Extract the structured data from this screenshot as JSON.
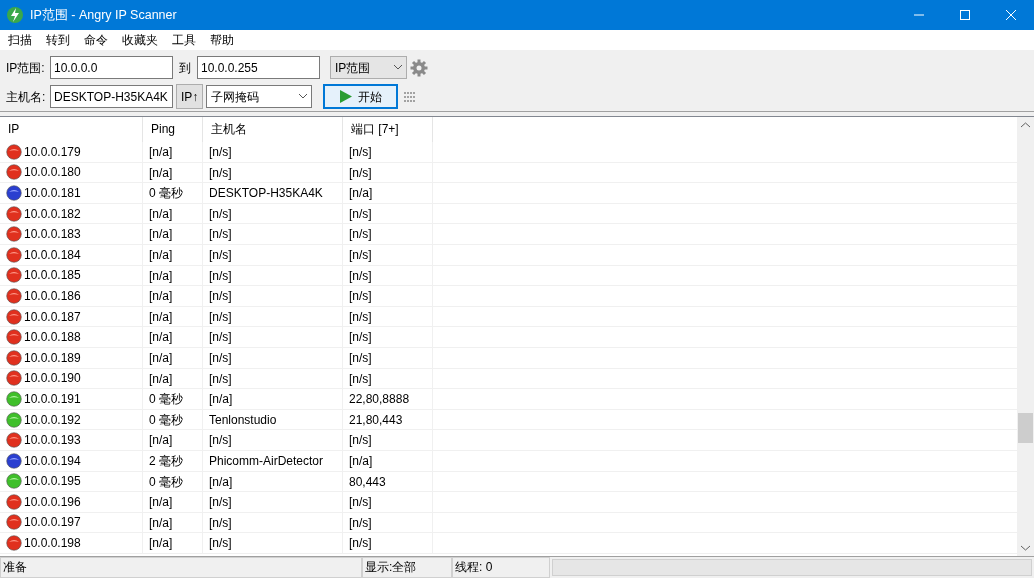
{
  "window": {
    "title": "IP范围 - Angry IP Scanner"
  },
  "menu": [
    "扫描",
    "转到",
    "命令",
    "收藏夹",
    "工具",
    "帮助"
  ],
  "toolbar": {
    "range_label": "IP范围:",
    "start_ip": "10.0.0.0",
    "to_label": "到",
    "end_ip": "10.0.0.255",
    "mode_select": "IP范围",
    "hostname_label": "主机名:",
    "hostname": "DESKTOP-H35KA4K",
    "ip_button": "IP↑",
    "netmask_select": "子网掩码",
    "start_button": "开始"
  },
  "table": {
    "columns": [
      "IP",
      "Ping",
      "主机名",
      "端口 [7+]"
    ],
    "rows": [
      {
        "color": "#e0301e",
        "ip": "10.0.0.179",
        "ping": "[n/a]",
        "hostname": "[n/s]",
        "ports": "[n/s]"
      },
      {
        "color": "#e0301e",
        "ip": "10.0.0.180",
        "ping": "[n/a]",
        "hostname": "[n/s]",
        "ports": "[n/s]"
      },
      {
        "color": "#2a3fd0",
        "ip": "10.0.0.181",
        "ping": "0 毫秒",
        "hostname": "DESKTOP-H35KA4K",
        "ports": "[n/a]"
      },
      {
        "color": "#e0301e",
        "ip": "10.0.0.182",
        "ping": "[n/a]",
        "hostname": "[n/s]",
        "ports": "[n/s]"
      },
      {
        "color": "#e0301e",
        "ip": "10.0.0.183",
        "ping": "[n/a]",
        "hostname": "[n/s]",
        "ports": "[n/s]"
      },
      {
        "color": "#e0301e",
        "ip": "10.0.0.184",
        "ping": "[n/a]",
        "hostname": "[n/s]",
        "ports": "[n/s]"
      },
      {
        "color": "#e0301e",
        "ip": "10.0.0.185",
        "ping": "[n/a]",
        "hostname": "[n/s]",
        "ports": "[n/s]"
      },
      {
        "color": "#e0301e",
        "ip": "10.0.0.186",
        "ping": "[n/a]",
        "hostname": "[n/s]",
        "ports": "[n/s]"
      },
      {
        "color": "#e0301e",
        "ip": "10.0.0.187",
        "ping": "[n/a]",
        "hostname": "[n/s]",
        "ports": "[n/s]"
      },
      {
        "color": "#e0301e",
        "ip": "10.0.0.188",
        "ping": "[n/a]",
        "hostname": "[n/s]",
        "ports": "[n/s]"
      },
      {
        "color": "#e0301e",
        "ip": "10.0.0.189",
        "ping": "[n/a]",
        "hostname": "[n/s]",
        "ports": "[n/s]"
      },
      {
        "color": "#e0301e",
        "ip": "10.0.0.190",
        "ping": "[n/a]",
        "hostname": "[n/s]",
        "ports": "[n/s]"
      },
      {
        "color": "#3fbf2a",
        "ip": "10.0.0.191",
        "ping": "0 毫秒",
        "hostname": "[n/a]",
        "ports": "22,80,8888"
      },
      {
        "color": "#3fbf2a",
        "ip": "10.0.0.192",
        "ping": "0 毫秒",
        "hostname": "Tenlonstudio",
        "ports": "21,80,443"
      },
      {
        "color": "#e0301e",
        "ip": "10.0.0.193",
        "ping": "[n/a]",
        "hostname": "[n/s]",
        "ports": "[n/s]"
      },
      {
        "color": "#2a3fd0",
        "ip": "10.0.0.194",
        "ping": "2 毫秒",
        "hostname": "Phicomm-AirDetector",
        "ports": "[n/a]"
      },
      {
        "color": "#3fbf2a",
        "ip": "10.0.0.195",
        "ping": "0 毫秒",
        "hostname": "[n/a]",
        "ports": "80,443"
      },
      {
        "color": "#e0301e",
        "ip": "10.0.0.196",
        "ping": "[n/a]",
        "hostname": "[n/s]",
        "ports": "[n/s]"
      },
      {
        "color": "#e0301e",
        "ip": "10.0.0.197",
        "ping": "[n/a]",
        "hostname": "[n/s]",
        "ports": "[n/s]"
      },
      {
        "color": "#e0301e",
        "ip": "10.0.0.198",
        "ping": "[n/a]",
        "hostname": "[n/s]",
        "ports": "[n/s]"
      }
    ]
  },
  "status_bar": {
    "message": "准备",
    "display": "显示:全部",
    "threads": "线程: 0",
    "progress": {
      "level": 0
    }
  }
}
